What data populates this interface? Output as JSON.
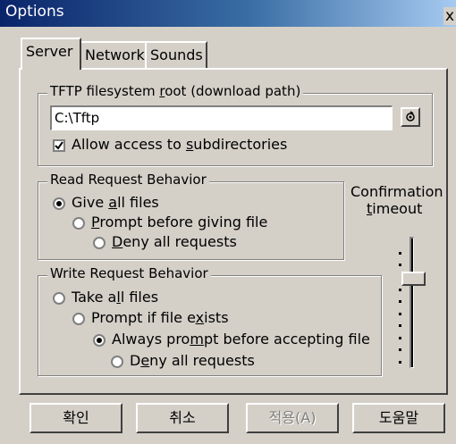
{
  "window": {
    "title": "Options",
    "close_label": "x"
  },
  "tabs": [
    {
      "label": "Server",
      "active": true
    },
    {
      "label": "Network",
      "active": false
    },
    {
      "label": "Sounds",
      "active": false
    }
  ],
  "tftp_root": {
    "legend_pre": "TFTP filesystem ",
    "legend_accel": "r",
    "legend_post": "oot (download path)",
    "path_value": "C:\\Tftp",
    "browse_icon": "folder-browse-icon",
    "allow_sub_pre": "Allow access to ",
    "allow_sub_accel": "s",
    "allow_sub_post": "ubdirectories",
    "allow_sub_checked": true
  },
  "read_behavior": {
    "legend": "Read Request Behavior",
    "options": [
      {
        "pre": "Give ",
        "accel": "a",
        "post": "ll files",
        "checked": true
      },
      {
        "pre": "",
        "accel": "P",
        "post": "rompt before giving file",
        "checked": false
      },
      {
        "pre": "",
        "accel": "D",
        "post": "eny all requests",
        "checked": false
      }
    ]
  },
  "write_behavior": {
    "legend": "Write Request Behavior",
    "options": [
      {
        "pre": "Take a",
        "accel": "l",
        "post": "l files",
        "checked": false
      },
      {
        "pre": "Prompt if file e",
        "accel": "x",
        "post": "ists",
        "checked": false
      },
      {
        "pre": "Always pro",
        "accel": "m",
        "post": "pt before accepting file",
        "checked": true
      },
      {
        "pre": "D",
        "accel": "e",
        "post": "ny all requests",
        "checked": false
      }
    ]
  },
  "confirmation": {
    "line1": "Confirmation",
    "line2_accel": "t",
    "line2_post": "imeout"
  },
  "buttons": {
    "ok": "확인",
    "cancel": "취소",
    "apply": "적용(A)",
    "help": "도움말"
  }
}
